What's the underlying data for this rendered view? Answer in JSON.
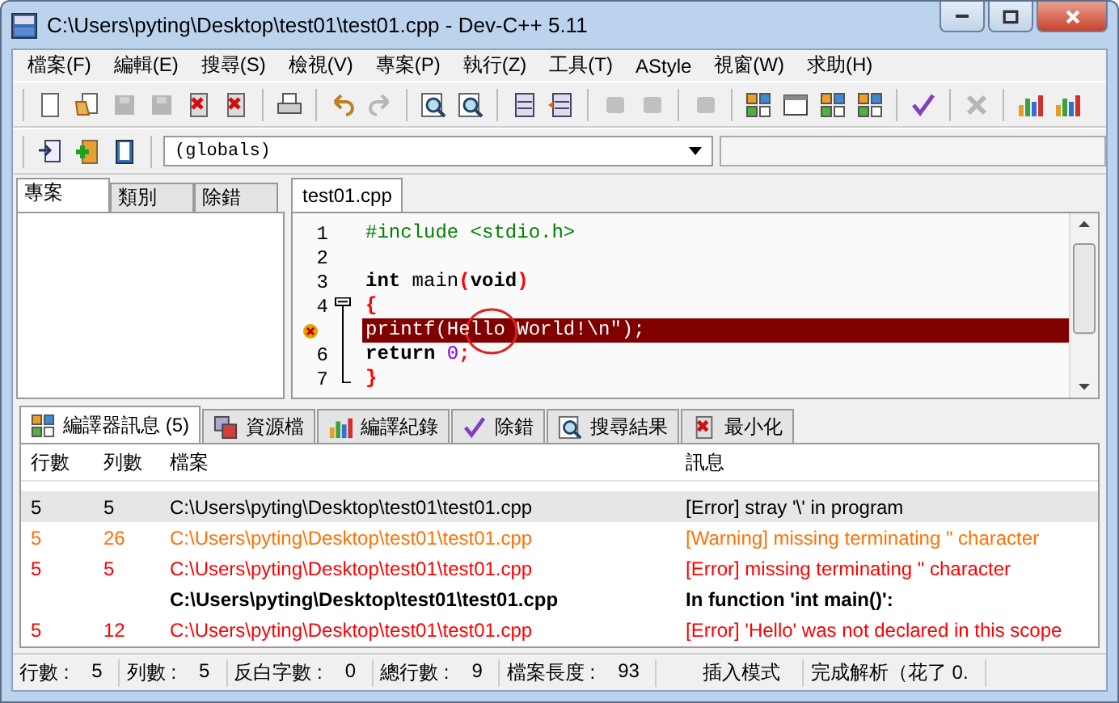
{
  "window": {
    "title": "C:\\Users\\pyting\\Desktop\\test01\\test01.cpp - Dev-C++ 5.11"
  },
  "menu": [
    "檔案(F)",
    "編輯(E)",
    "搜尋(S)",
    "檢視(V)",
    "專案(P)",
    "執行(Z)",
    "工具(T)",
    "AStyle",
    "視窗(W)",
    "求助(H)"
  ],
  "toolbar": [
    [
      {
        "disabled": false
      },
      {
        "disabled": false
      },
      {
        "disabled": true
      },
      {
        "disabled": true
      },
      {
        "disabled": false
      },
      {
        "disabled": false
      }
    ],
    [
      {
        "disabled": false
      }
    ],
    [
      {
        "disabled": false
      },
      {
        "disabled": true
      }
    ],
    [
      {
        "disabled": false
      },
      {
        "disabled": false
      }
    ],
    [
      {
        "disabled": false
      },
      {
        "disabled": false
      }
    ],
    [
      {
        "disabled": true
      },
      {
        "disabled": true
      }
    ],
    [
      {
        "disabled": true
      }
    ],
    [
      {
        "disabled": false
      },
      {
        "disabled": false
      },
      {
        "disabled": false
      },
      {
        "disabled": false
      }
    ],
    [
      {
        "disabled": false
      }
    ],
    [
      {
        "disabled": true
      }
    ],
    [
      {
        "disabled": false
      },
      {
        "disabled": false
      }
    ]
  ],
  "scope_dropdown": {
    "value": "(globals)"
  },
  "left_tabs": [
    {
      "label": "專案",
      "selected": true
    },
    {
      "label": "類別",
      "selected": false
    },
    {
      "label": "除錯",
      "selected": false
    }
  ],
  "editor_tab": {
    "label": "test01.cpp"
  },
  "code": [
    {
      "number": "1",
      "tokens": [
        {
          "text": "#include <stdio.h>",
          "kind": "preproc"
        }
      ]
    },
    {
      "number": "2"
    },
    {
      "number": "3",
      "tokens": [
        {
          "text": "int",
          "kind": "keyword"
        },
        {
          "text": " main",
          "kind": "plain"
        },
        {
          "text": "(",
          "kind": "symbol"
        },
        {
          "text": "void",
          "kind": "keyword"
        },
        {
          "text": ")",
          "kind": "symbol"
        }
      ]
    },
    {
      "number": "4",
      "expanded": true,
      "tokens": [
        {
          "text": "{",
          "kind": "symbol"
        }
      ]
    },
    {
      "error": true,
      "circled": true,
      "indented": true,
      "tokens": [
        {
          "text": "printf(Hello World!\\n\");",
          "kind": "plain"
        }
      ]
    },
    {
      "number": "6",
      "indented": true,
      "tokens": [
        {
          "text": "return",
          "kind": "keyword"
        },
        {
          "text": " 0",
          "kind": "number"
        },
        {
          "text": ";",
          "kind": "symbol"
        }
      ]
    },
    {
      "number": "7",
      "tokens": [
        {
          "text": "}",
          "kind": "symbol"
        }
      ]
    }
  ],
  "bottom_tabs": [
    {
      "label": "編譯器訊息 (5)",
      "selected": true
    },
    {
      "label": "資源檔",
      "selected": false
    },
    {
      "label": "編譯紀錄",
      "selected": false
    },
    {
      "label": "除錯",
      "selected": false
    },
    {
      "label": "搜尋結果",
      "selected": false
    },
    {
      "label": "最小化",
      "selected": false
    }
  ],
  "messages": {
    "columns": [
      "行數",
      "列數",
      "檔案",
      "訊息"
    ],
    "rows": [
      {
        "kind": "error",
        "selected": true,
        "cells": [
          "5",
          "5",
          "C:\\Users\\pyting\\Desktop\\test01\\test01.cpp",
          "[Error] stray '\\' in program"
        ]
      },
      {
        "kind": "warning",
        "selected": false,
        "cells": [
          "5",
          "26",
          "C:\\Users\\pyting\\Desktop\\test01\\test01.cpp",
          "[Warning] missing terminating \" character"
        ]
      },
      {
        "kind": "error",
        "selected": false,
        "cells": [
          "5",
          "5",
          "C:\\Users\\pyting\\Desktop\\test01\\test01.cpp",
          "[Error] missing terminating \" character"
        ]
      },
      {
        "kind": "context",
        "selected": false,
        "cells": [
          "",
          "",
          "C:\\Users\\pyting\\Desktop\\test01\\test01.cpp",
          "In function 'int main()':"
        ]
      },
      {
        "kind": "error",
        "selected": false,
        "cells": [
          "5",
          "12",
          "C:\\Users\\pyting\\Desktop\\test01\\test01.cpp",
          "[Error] 'Hello' was not declared in this scope"
        ]
      }
    ]
  },
  "status_bar": [
    {
      "label": "行數 :",
      "value": "5"
    },
    {
      "label": "列數 :",
      "value": "5"
    },
    {
      "label": "反白字數 :",
      "value": "0"
    },
    {
      "label": "總行數 :",
      "value": "9"
    },
    {
      "label": "檔案長度 :",
      "value": "93"
    },
    {
      "label": "插入模式"
    },
    {
      "label": "完成解析（花了 0."
    }
  ]
}
